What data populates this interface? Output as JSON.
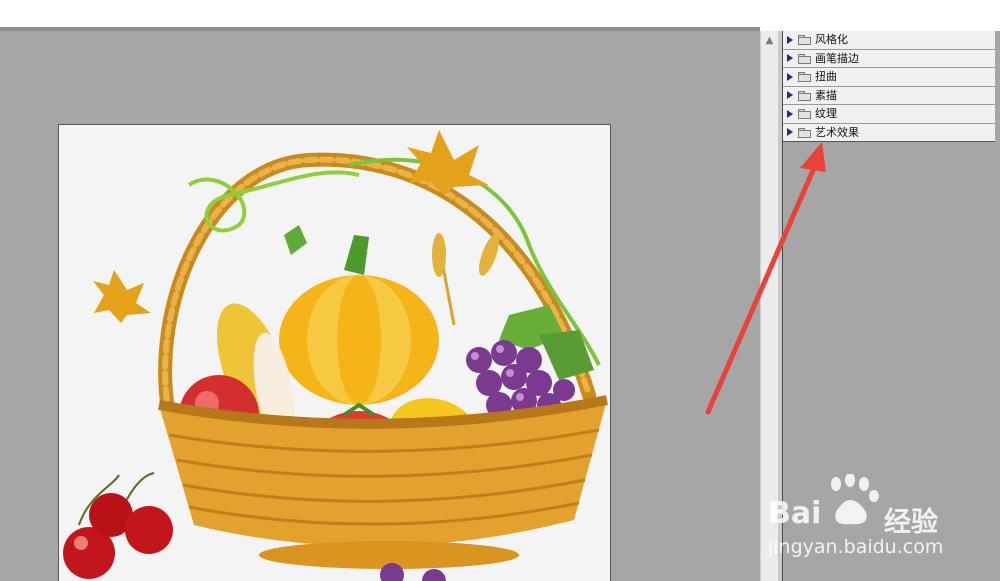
{
  "filter_gallery": {
    "categories": [
      {
        "label": "风格化"
      },
      {
        "label": "画笔描边"
      },
      {
        "label": "扭曲"
      },
      {
        "label": "素描"
      },
      {
        "label": "纹理"
      },
      {
        "label": "艺术效果"
      }
    ]
  },
  "watermark": {
    "brand_left": "Bai",
    "brand_right": "经验",
    "url": "jingyan.baidu.com"
  },
  "colors": {
    "canvas_bg": "#a6a6a6",
    "panel_bg": "#f0f0f0",
    "annotation_arrow": "#e8423a"
  },
  "icons": [
    "expand-triangle-icon",
    "folder-icon",
    "scroll-up-arrow-icon",
    "baidu-paw-logo"
  ]
}
